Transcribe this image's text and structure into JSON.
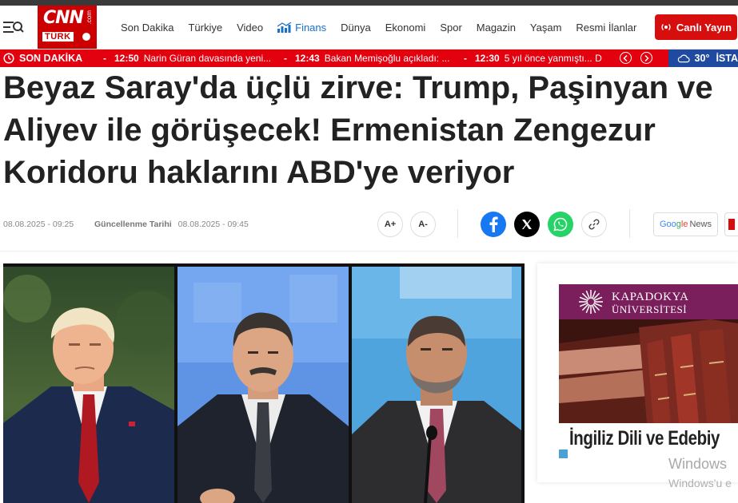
{
  "nav": {
    "logo_top": "CNN",
    "logo_com": ".com",
    "logo_bottom": "TÜRK",
    "links": [
      "Son Dakika",
      "Türkiye",
      "Video",
      "Finans",
      "Dünya",
      "Ekonomi",
      "Spor",
      "Magazin",
      "Yaşam",
      "Resmi İlanlar"
    ],
    "live_label": "Canlı Yayın"
  },
  "breaking": {
    "label": "SON DAKİKA",
    "items": [
      {
        "time": "12:50",
        "text": "Narin Güran davasında yeni..."
      },
      {
        "time": "12:43",
        "text": "Bakan Memişoğlu açıkladı: ..."
      },
      {
        "time": "12:30",
        "text": "5 yıl önce yanmıştı... D"
      }
    ]
  },
  "weather": {
    "temp": "30°",
    "city": "İSTA"
  },
  "article": {
    "headline_lines": [
      "Beyaz Saray'da üçlü zirve: Trump, Paşinyan ve",
      "Aliyev ile görüşecek! Ermenistan Zengezur",
      "Koridoru haklarını ABD'ye veriyor"
    ],
    "published": "08.08.2025 - 09:25",
    "updated_label": "Güncellenme Tarihi",
    "updated": "08.08.2025 - 09:45",
    "font_increase": "A+",
    "font_decrease": "A-",
    "google_news_1": "Goo",
    "google_news_2": "g",
    "google_news_3": "l",
    "google_news_4": "e",
    "google_news_5": "News"
  },
  "ad": {
    "brand_line1": "KAPADOKYA",
    "brand_line2": "ÜNİVERSİTESİ",
    "caption": "İngiliz Dili ve Edebiy"
  },
  "watermark": {
    "line1": "Windows",
    "line2": "Windows'u e"
  },
  "colors": {
    "brand_red": "#cc0000",
    "breaking_red": "#e3000f",
    "weather_blue": "#1f4aa0",
    "ad_purple": "#7a1e5c",
    "finans_blue": "#1a6fc9"
  },
  "icons": [
    "menu-search-icon",
    "finans-chart-icon",
    "live-broadcast-icon",
    "clock-icon",
    "chevron-left-icon",
    "chevron-right-icon",
    "cloud-icon",
    "facebook-icon",
    "x-icon",
    "whatsapp-icon",
    "link-icon"
  ]
}
